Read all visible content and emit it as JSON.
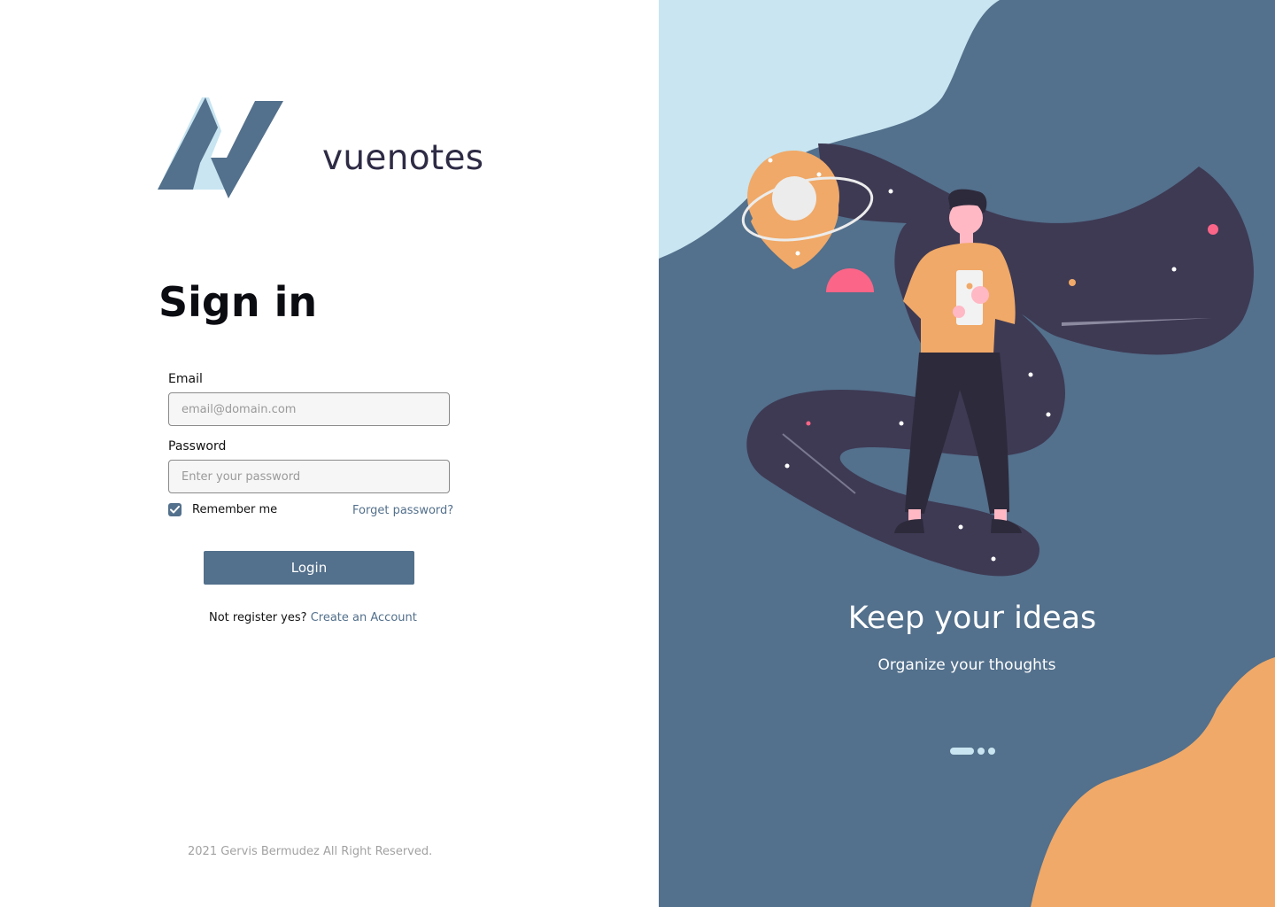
{
  "brand": {
    "name": "vuenotes",
    "logo_icon": "vuenotes-logo-icon"
  },
  "form": {
    "title": "Sign in",
    "email_label": "Email",
    "email_placeholder": "email@domain.com",
    "password_label": "Password",
    "password_placeholder": "Enter your password",
    "remember_label": "Remember me",
    "remember_checked": true,
    "forgot_link": "Forget password?",
    "login_label": "Login",
    "signup_prompt": "Not register yes?",
    "signup_link": "Create an Account"
  },
  "footer": {
    "text": "2021 Gervis Bermudez All Right Reserved."
  },
  "hero": {
    "title": "Keep your ideas",
    "subtitle": "Organize your thoughts",
    "slides": 3,
    "active_slide": 1,
    "illustration": "person-with-phone-space-illustration"
  },
  "colors": {
    "primary": "#53708c",
    "light_blue": "#c8e5f1",
    "orange": "#f0a968",
    "dark_purple": "#3e3a54",
    "pink": "#fb6587"
  }
}
